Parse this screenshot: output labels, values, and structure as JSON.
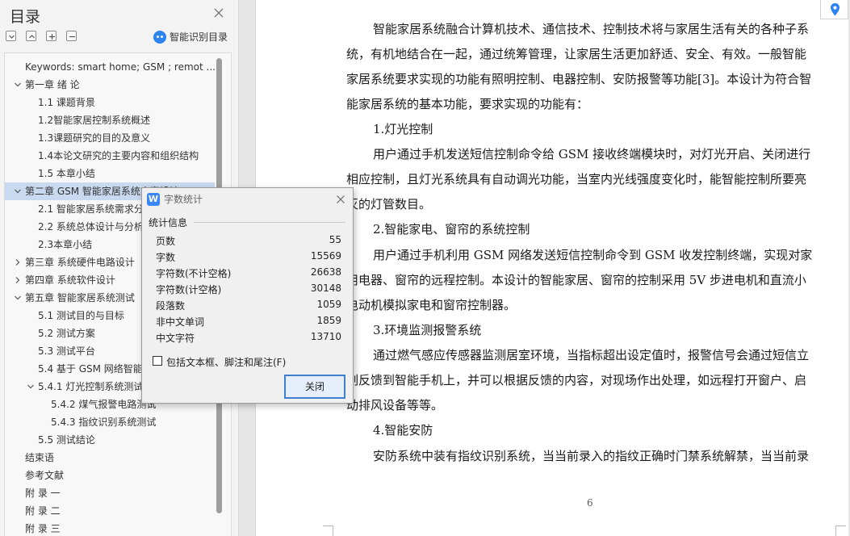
{
  "nav": {
    "title": "目录",
    "smart_toc_label": "智能识别目录",
    "toc": [
      {
        "label": "Keywords: smart home; GSM ; remot ...",
        "expand": "",
        "selected": false
      },
      {
        "label": "第一章 绪 论",
        "expand": "expanded",
        "selected": false
      },
      {
        "label": "1.1 课题背景",
        "expand": "",
        "selected": false
      },
      {
        "label": "1.2智能家居控制系统概述",
        "expand": "",
        "selected": false
      },
      {
        "label": "1.3课题研究的目的及意义",
        "expand": "",
        "selected": false
      },
      {
        "label": "1.4本论文研究的主要内容和组织结构",
        "expand": "",
        "selected": false
      },
      {
        "label": "1.5 本章小结",
        "expand": "",
        "selected": false
      },
      {
        "label": "第二章 GSM 智能家居系统方案设计",
        "expand": "expanded",
        "selected": true
      },
      {
        "label": "2.1 智能家居系统需求分析",
        "expand": "",
        "selected": false
      },
      {
        "label": "2.2 系统总体设计与分析",
        "expand": "",
        "selected": false
      },
      {
        "label": "2.3本章小结",
        "expand": "",
        "selected": false
      },
      {
        "label": "第三章 系统硬件电路设计",
        "expand": "collapsed",
        "selected": false
      },
      {
        "label": "第四章 系统软件设计",
        "expand": "collapsed",
        "selected": false
      },
      {
        "label": "第五章 智能家居系统测试",
        "expand": "expanded",
        "selected": false
      },
      {
        "label": "5.1 测试目的与目标",
        "expand": "",
        "selected": false
      },
      {
        "label": "5.2 测试方案",
        "expand": "",
        "selected": false
      },
      {
        "label": "5.3 测试平台",
        "expand": "",
        "selected": false
      },
      {
        "label": "5.4 基于 GSM 网络智能家居系统测试",
        "expand": "",
        "selected": false
      },
      {
        "label": "5.4.1 灯光控制系统测试",
        "expand": "expanded",
        "selected": false
      },
      {
        "label": "5.4.2 煤气报警电路测试",
        "expand": "",
        "selected": false
      },
      {
        "label": "5.4.3 指纹识别系统测试",
        "expand": "",
        "selected": false
      },
      {
        "label": "5.5 测试结论",
        "expand": "",
        "selected": false
      },
      {
        "label": "结束语",
        "expand": "",
        "selected": false
      },
      {
        "label": "参考文献",
        "expand": "",
        "selected": false
      },
      {
        "label": "附 录 一",
        "expand": "",
        "selected": false
      },
      {
        "label": "附 录 二",
        "expand": "",
        "selected": false
      },
      {
        "label": "附 录 三",
        "expand": "",
        "selected": false
      }
    ]
  },
  "document": {
    "lines": [
      "智能家居系统融合计算机技术、通信技术、控制技术将与家居生活有关的各种子系",
      "统，有机地结合在一起，通过统筹管理，让家居生活更加舒适、安全、有效。一般智能",
      "家居系统要求实现的功能有照明控制、电器控制、安防报警等功能[3]。本设计为符合智",
      "能家居系统的基本功能，要求实现的功能有：",
      "1.灯光控制",
      "用户通过手机发送短信控制命令给 GSM 接收终端模块时，对灯光开启、关闭进行",
      "相应控制，且灯光系统具有自动调光功能，当室内光线强度变化时，能智能控制所要亮",
      "灭的灯管数目。",
      "2.智能家电、窗帘的系统控制",
      "用户通过手机利用 GSM 网络发送短信控制命令到 GSM 收发控制终端，实现对家",
      "用电器、窗帘的远程控制。本设计的智能家居、窗帘的控制采用 5V 步进电机和直流小",
      "电动机模拟家电和窗帘控制器。",
      "3.环境监测报警系统",
      "通过燃气感应传感器监测居室环境，当指标超出设定值时，报警信号会通过短信立",
      "刻反馈到智能手机上，并可以根据反馈的内容，对现场作出处理，如远程打开窗户、启",
      "动排风设备等等。",
      "4.智能安防",
      "安防系统中装有指纹识别系统，当当前录入的指纹正确时门禁系统解禁，当当前录"
    ],
    "page_number": "6"
  },
  "dialog": {
    "icon_letter": "W",
    "title": "字数统计",
    "group_label": "统计信息",
    "stats": [
      {
        "label": "页数",
        "value": "55"
      },
      {
        "label": "字数",
        "value": "15569"
      },
      {
        "label": "字符数(不计空格)",
        "value": "26638"
      },
      {
        "label": "字符数(计空格)",
        "value": "30148"
      },
      {
        "label": "段落数",
        "value": "1059"
      },
      {
        "label": "非中文单词",
        "value": "1859"
      },
      {
        "label": "中文字符",
        "value": "13710"
      }
    ],
    "checkbox_label": "包括文本框、脚注和尾注(F)",
    "checkbox_checked": false,
    "close_button": "关闭"
  },
  "colors": {
    "accent": "#2b84f0",
    "selection": "#c9d9ef",
    "button_border": "#3f7fcf"
  }
}
